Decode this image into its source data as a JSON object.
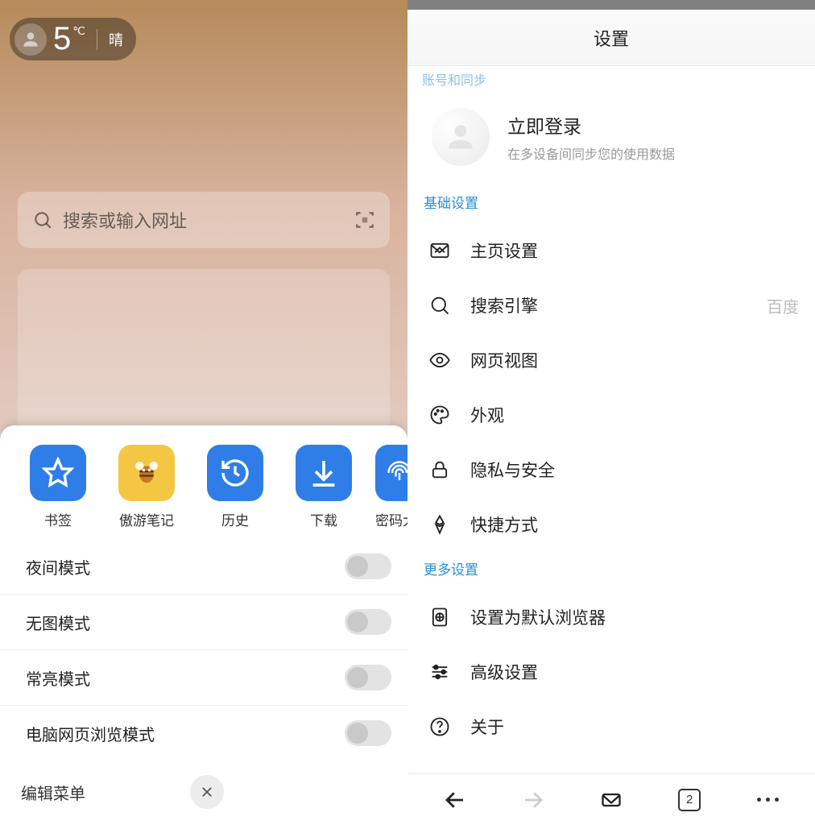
{
  "left": {
    "weather": {
      "temp": "5",
      "unit": "℃",
      "condition": "晴"
    },
    "search_placeholder": "搜索或输入网址",
    "tiles": [
      {
        "label": "书签"
      },
      {
        "label": "傲游笔记"
      },
      {
        "label": "历史"
      },
      {
        "label": "下载"
      },
      {
        "label": "密码大师"
      }
    ],
    "toggles": [
      {
        "label": "夜间模式"
      },
      {
        "label": "无图模式"
      },
      {
        "label": "常亮模式"
      },
      {
        "label": "电脑网页浏览模式"
      }
    ],
    "edit_label": "编辑菜单"
  },
  "right": {
    "header": "设置",
    "truncated_top": "账号和同步",
    "login": {
      "title": "立即登录",
      "subtitle": "在多设备间同步您的使用数据"
    },
    "section1": "基础设置",
    "items1": [
      {
        "label": "主页设置"
      },
      {
        "label": "搜索引擎",
        "value": "百度"
      },
      {
        "label": "网页视图"
      },
      {
        "label": "外观"
      },
      {
        "label": "隐私与安全"
      },
      {
        "label": "快捷方式"
      }
    ],
    "section2": "更多设置",
    "items2": [
      {
        "label": "设置为默认浏览器"
      },
      {
        "label": "高级设置"
      },
      {
        "label": "关于"
      }
    ],
    "tab_count": "2"
  }
}
